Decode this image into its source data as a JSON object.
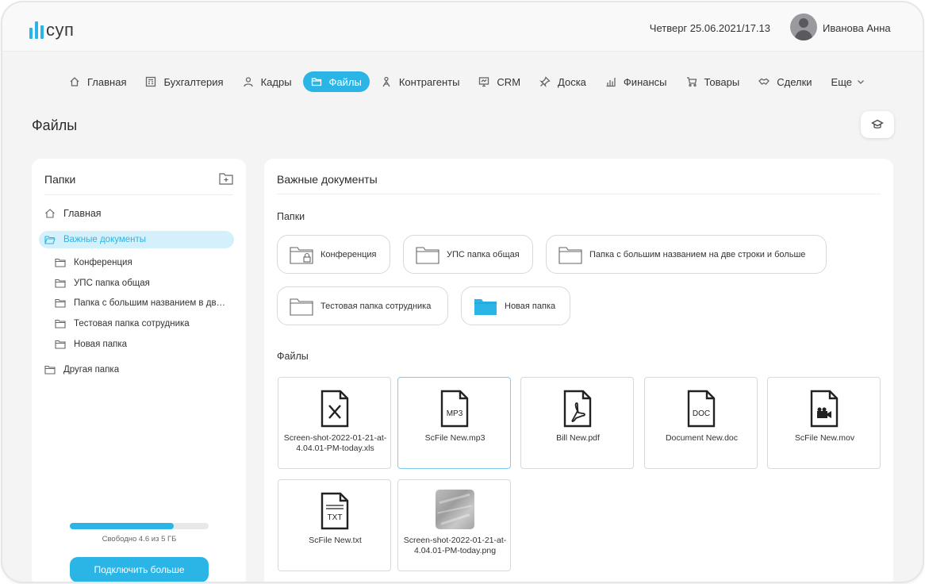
{
  "app": {
    "logo_text": "cуп",
    "datetime": "Четверг 25.06.2021/17.13",
    "user_name": "Иванова Анна"
  },
  "nav": {
    "items": [
      {
        "label": "Главная",
        "icon": "home-icon"
      },
      {
        "label": "Бухгалтерия",
        "icon": "calculator-icon"
      },
      {
        "label": "Кадры",
        "icon": "person-icon"
      },
      {
        "label": "Файлы",
        "icon": "folder-icon",
        "active": true
      },
      {
        "label": "Контрагенты",
        "icon": "partners-icon"
      },
      {
        "label": "CRM",
        "icon": "crm-icon"
      },
      {
        "label": "Доска",
        "icon": "pin-icon"
      },
      {
        "label": "Финансы",
        "icon": "chart-icon"
      },
      {
        "label": "Товары",
        "icon": "cart-icon"
      },
      {
        "label": "Сделки",
        "icon": "handshake-icon"
      }
    ],
    "more_label": "Еще"
  },
  "page": {
    "title": "Файлы"
  },
  "sidebar": {
    "title": "Папки",
    "home_label": "Главная",
    "selected_label": "Важные документы",
    "subfolders": [
      "Конференция",
      "УПС папка общая",
      "Папка с большим названием в две строки и больше",
      "Тестовая папка сотрудника",
      "Новая папка"
    ],
    "other_folder": "Другая папка",
    "storage": {
      "used_fraction": 0.75,
      "text": "Свободно 4.6 из 5 ГБ"
    },
    "more_button": "Подключить больше"
  },
  "main": {
    "title": "Важные документы",
    "folders_label": "Папки",
    "folders": [
      {
        "label": "Конференция",
        "type": "locked"
      },
      {
        "label": "УПС папка общая",
        "type": "outline"
      },
      {
        "label": "Папка с большим названием на две строки и больше",
        "type": "outline"
      },
      {
        "label": "Тестовая папка сотрудника",
        "type": "outline"
      },
      {
        "label": "Новая папка",
        "type": "filled"
      }
    ],
    "files_label": "Файлы",
    "files": [
      {
        "name": "Screen-shot-2022-01-21-at-4.04.01-PM-today.xls",
        "icon": "xls-file-icon",
        "badge": ""
      },
      {
        "name": "ScFile New.mp3",
        "icon": "mp3-file-icon",
        "badge": "MP3",
        "selected": true
      },
      {
        "name": "Bill New.pdf",
        "icon": "pdf-file-icon",
        "badge": ""
      },
      {
        "name": "Document New.doc",
        "icon": "doc-file-icon",
        "badge": "DOC"
      },
      {
        "name": "ScFile New.mov",
        "icon": "video-file-icon",
        "badge": ""
      },
      {
        "name": "ScFile New.txt",
        "icon": "txt-file-icon",
        "badge": "TXT"
      },
      {
        "name": "Screen-shot-2022-01-21-at-4.04.01-PM-today.png",
        "icon": "image-thumbnail",
        "badge": ""
      }
    ]
  }
}
